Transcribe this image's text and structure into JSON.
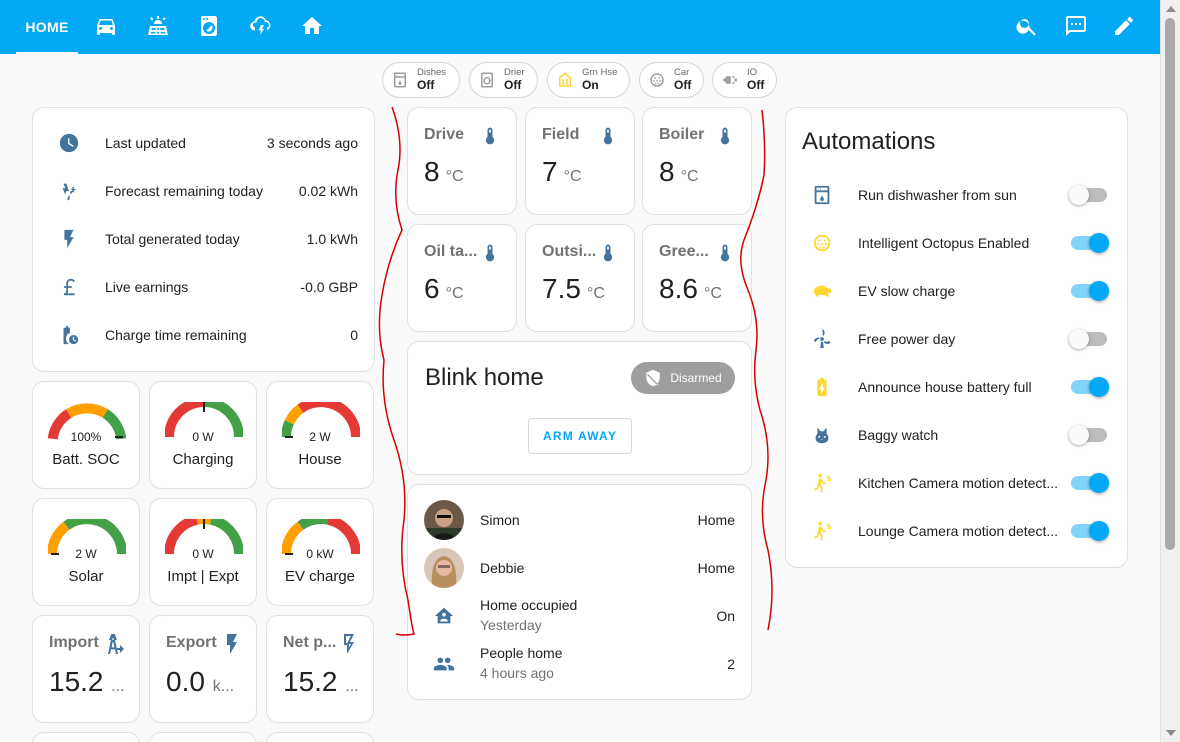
{
  "topbar": {
    "home_tab": "HOME",
    "tabs": [
      "car-icon",
      "solar-panel-icon",
      "washing-machine-icon",
      "cloud-lightning-icon",
      "house-icon"
    ],
    "actions": [
      "search-icon",
      "chat-icon",
      "pencil-icon"
    ]
  },
  "chips": [
    {
      "label": "Dishes",
      "state": "Off",
      "icon": "dishwasher-icon"
    },
    {
      "label": "Drier",
      "state": "Off",
      "icon": "tumble-dryer-icon"
    },
    {
      "label": "Grn Hse",
      "state": "On",
      "icon": "greenhouse-icon",
      "color": "#fdd835"
    },
    {
      "label": "Car",
      "state": "Off",
      "icon": "ev-plug-icon"
    },
    {
      "label": "IO",
      "state": "Off",
      "icon": "power-plug-icon"
    }
  ],
  "info": [
    {
      "label": "Last updated",
      "value": "3 seconds ago",
      "icon": "clock-icon"
    },
    {
      "label": "Forecast remaining today",
      "value": "0.02 kWh",
      "icon": "weather-lightning-icon"
    },
    {
      "label": "Total generated today",
      "value": "1.0 kWh",
      "icon": "flash-icon"
    },
    {
      "label": "Live earnings",
      "value": "-0.0 GBP",
      "icon": "currency-gbp-icon"
    },
    {
      "label": "Charge time remaining",
      "value": "0",
      "icon": "battery-clock-icon"
    }
  ],
  "gauges": [
    {
      "name": "Batt. SOC",
      "value": "100%",
      "level": 1.0
    },
    {
      "name": "Charging",
      "value": "0 W",
      "level": 0.5
    },
    {
      "name": "House",
      "value": "2 W",
      "level": 0.0
    },
    {
      "name": "Solar",
      "value": "2 W",
      "level": 0.0
    },
    {
      "name": "Impt | Expt",
      "value": "0 W",
      "level": 0.5
    },
    {
      "name": "EV charge",
      "value": "0 kW",
      "level": 0.0
    }
  ],
  "stats": [
    {
      "name": "Import",
      "value": "15.2",
      "unit": "...",
      "icon": "transmission-tower-import-icon"
    },
    {
      "name": "Export",
      "value": "0.0",
      "unit": "k...",
      "icon": "flash-icon"
    },
    {
      "name": "Net p...",
      "value": "15.2",
      "unit": "...",
      "icon": "flash-outline-icon"
    }
  ],
  "temps": [
    {
      "name": "Drive",
      "value": "8",
      "unit": "°C"
    },
    {
      "name": "Field",
      "value": "7",
      "unit": "°C"
    },
    {
      "name": "Boiler",
      "value": "8",
      "unit": "°C"
    },
    {
      "name": "Oil ta...",
      "value": "6",
      "unit": "°C"
    },
    {
      "name": "Outsi...",
      "value": "7.5",
      "unit": "°C"
    },
    {
      "name": "Gree...",
      "value": "8.6",
      "unit": "°C"
    }
  ],
  "blink": {
    "title": "Blink home",
    "status": "Disarmed",
    "button": "ARM AWAY"
  },
  "people": [
    {
      "name": "Simon",
      "state": "Home"
    },
    {
      "name": "Debbie",
      "state": "Home"
    }
  ],
  "presence": [
    {
      "label": "Home occupied",
      "sub": "Yesterday",
      "state": "On",
      "icon": "home-account-icon"
    },
    {
      "label": "People home",
      "sub": "4 hours ago",
      "state": "2",
      "icon": "account-group-icon"
    }
  ],
  "automations": {
    "title": "Automations",
    "items": [
      {
        "label": "Run dishwasher from sun",
        "on": false,
        "icon": "dishwasher-icon",
        "color": "#44739e"
      },
      {
        "label": "Intelligent Octopus Enabled",
        "on": true,
        "icon": "ev-plug-icon",
        "color": "#fdd835"
      },
      {
        "label": "EV slow charge",
        "on": true,
        "icon": "tortoise-icon",
        "color": "#fdd835"
      },
      {
        "label": "Free power day",
        "on": false,
        "icon": "wind-turbine-icon",
        "color": "#44739e"
      },
      {
        "label": "Announce house battery full",
        "on": true,
        "icon": "battery-charging-icon",
        "color": "#fdd835"
      },
      {
        "label": "Baggy watch",
        "on": false,
        "icon": "cat-icon",
        "color": "#44739e"
      },
      {
        "label": "Kitchen Camera motion detect...",
        "on": true,
        "icon": "motion-sensor-icon",
        "color": "#fdd835"
      },
      {
        "label": "Lounge Camera motion detect...",
        "on": true,
        "icon": "motion-sensor-icon",
        "color": "#fdd835"
      }
    ]
  }
}
